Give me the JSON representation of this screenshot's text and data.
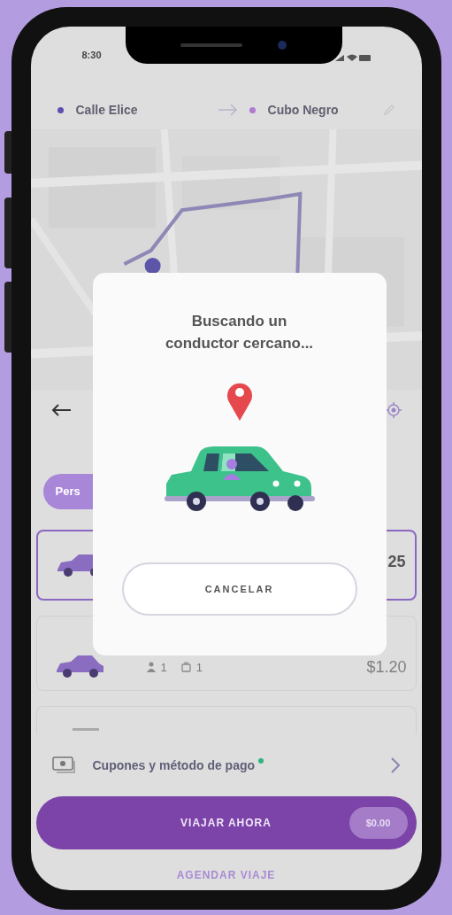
{
  "status_bar": {
    "time": "8:30"
  },
  "route": {
    "origin": "Calle Elice",
    "destination": "Cubo Negro"
  },
  "category_chip": {
    "label": "Pers",
    "selected": true
  },
  "rides": [
    {
      "kind": "full",
      "price": "25",
      "selected": true
    },
    {
      "kind": "full",
      "price": "$1.20",
      "seats": "1",
      "bags": "1",
      "selected": false
    },
    {
      "kind": "partial",
      "selected": false
    }
  ],
  "payment": {
    "label": "Cupones y método de pago",
    "promo_dot": true
  },
  "primary_button": {
    "label": "VIAJAR AHORA",
    "price": "$0.00"
  },
  "secondary_link": "AGENDAR VIAJE",
  "modal": {
    "title": "Buscando un conductor cercano...",
    "cancel": "CANCELAR"
  }
}
